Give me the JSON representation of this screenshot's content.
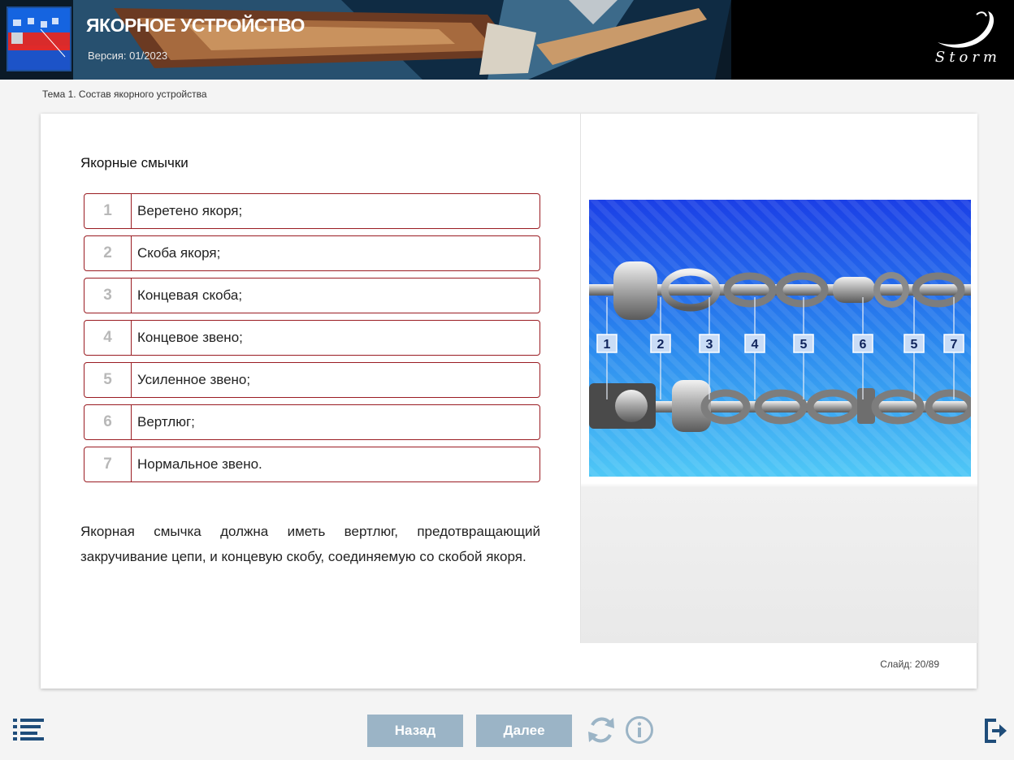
{
  "header": {
    "title": "ЯКОРНОЕ УСТРОЙСТВО",
    "version": "Версия: 01/2023",
    "logo_text": "Storm"
  },
  "breadcrumb": "Тема 1. Состав якорного устройства",
  "content": {
    "heading": "Якорные смычки",
    "items": [
      {
        "num": "1",
        "text": "Веретено якоря;"
      },
      {
        "num": "2",
        "text": "Скоба якоря;"
      },
      {
        "num": "3",
        "text": "Концевая скоба;"
      },
      {
        "num": "4",
        "text": "Концевое звено;"
      },
      {
        "num": "5",
        "text": "Усиленное звено;"
      },
      {
        "num": "6",
        "text": "Вертлюг;"
      },
      {
        "num": "7",
        "text": "Нормальное звено."
      }
    ],
    "paragraph": "Якорная смычка должна иметь вертлюг, предотвращающий закручивание цепи, и концевую скобу, соединяемую со скобой якоря.",
    "diagram_labels": [
      "1",
      "2",
      "3",
      "4",
      "5",
      "6",
      "5",
      "7"
    ]
  },
  "slide_counter": "Слайд: 20/89",
  "nav": {
    "back_label": "Назад",
    "next_label": "Далее"
  },
  "icons": {
    "menu": "menu-list-icon",
    "reload": "reload-icon",
    "info": "info-icon",
    "exit": "exit-icon"
  },
  "colors": {
    "header_bg": "#0b1a27",
    "item_border": "#9a1c22",
    "nav_button": "#9bb4c6",
    "icon": "#1f4d7a",
    "diagram_blue": "#1e64f0"
  }
}
